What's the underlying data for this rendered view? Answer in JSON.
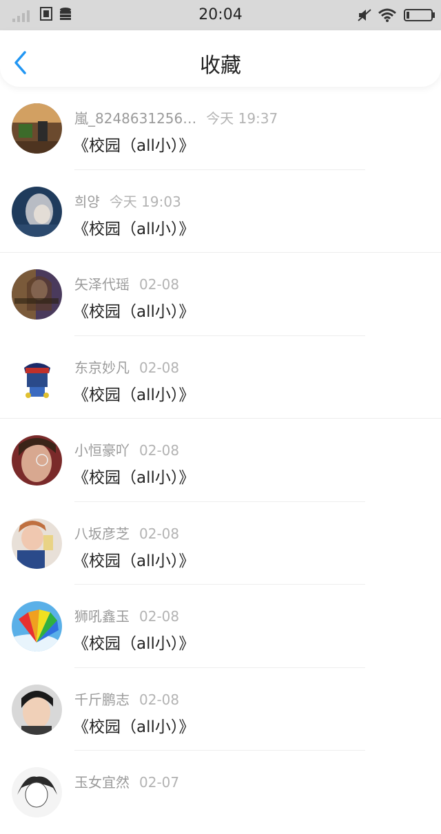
{
  "status_bar": {
    "time": "20:04"
  },
  "header": {
    "title": "收藏"
  },
  "items": [
    {
      "user": "嵐_8248631256…",
      "date": "今天 19:37",
      "title": "《校园（all小）》"
    },
    {
      "user": "희양",
      "date": "今天 19:03",
      "title": "《校园（all小）》"
    },
    {
      "user": "矢泽代瑶",
      "date": "02-08",
      "title": "《校园（all小）》"
    },
    {
      "user": "东京妙凡",
      "date": "02-08",
      "title": "《校园（all小）》"
    },
    {
      "user": "小恒豪吖",
      "date": "02-08",
      "title": "《校园（all小）》"
    },
    {
      "user": "八坂彦芝",
      "date": "02-08",
      "title": "《校园（all小）》"
    },
    {
      "user": "狮吼鑫玉",
      "date": "02-08",
      "title": "《校园（all小）》"
    },
    {
      "user": "千斤鹏志",
      "date": "02-08",
      "title": "《校园（all小）》"
    },
    {
      "user": "玉女宜然",
      "date": "02-07",
      "title": ""
    }
  ],
  "colors": {
    "accent": "#2196f3",
    "status_bar_bg": "#d9d9d9"
  }
}
